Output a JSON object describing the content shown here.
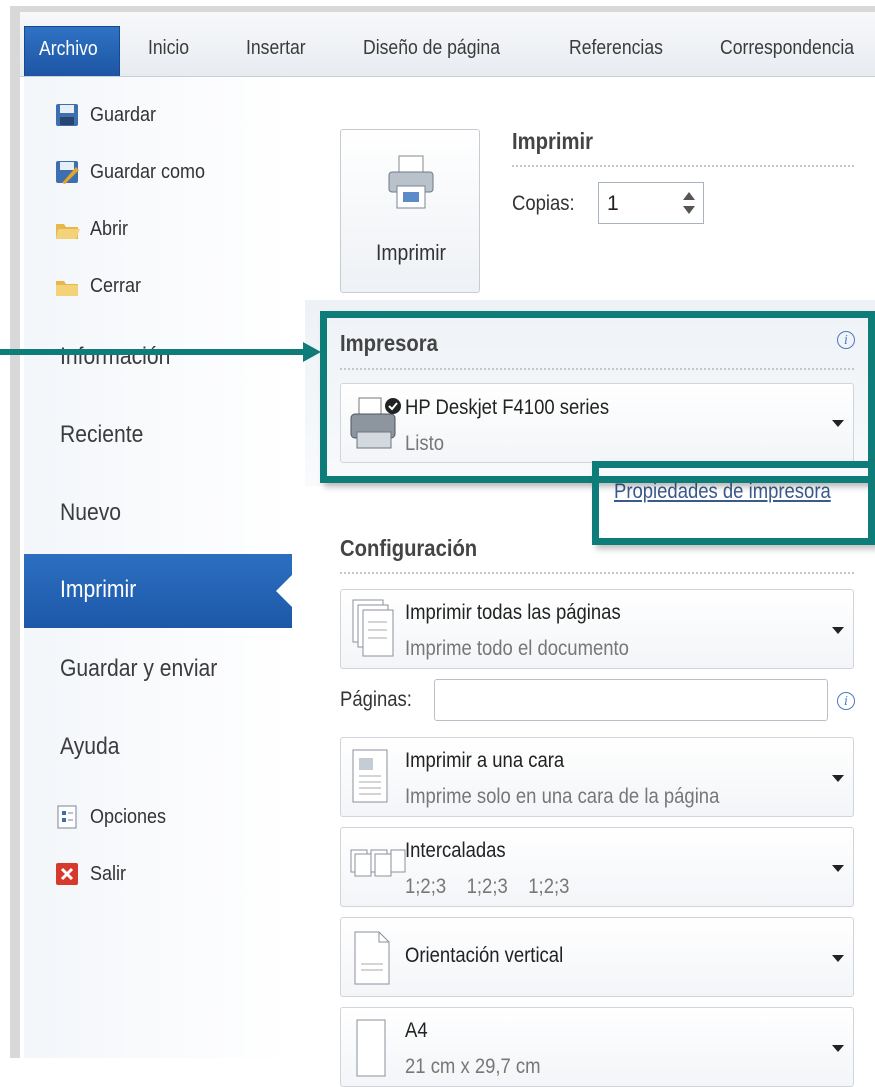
{
  "ribbon": {
    "tabs": [
      "Archivo",
      "Inicio",
      "Insertar",
      "Diseño de página",
      "Referencias",
      "Correspondencia"
    ],
    "active_tab": "Archivo"
  },
  "sidebar": {
    "small_items": [
      {
        "label": "Guardar",
        "icon": "save-icon"
      },
      {
        "label": "Guardar como",
        "icon": "save-as-icon"
      },
      {
        "label": "Abrir",
        "icon": "open-folder-icon"
      },
      {
        "label": "Cerrar",
        "icon": "close-folder-icon"
      }
    ],
    "big_items": [
      "Información",
      "Reciente",
      "Nuevo",
      "Imprimir",
      "Guardar y enviar",
      "Ayuda"
    ],
    "selected": "Imprimir",
    "bottom_items": [
      {
        "label": "Opciones",
        "icon": "options-icon"
      },
      {
        "label": "Salir",
        "icon": "exit-icon"
      }
    ]
  },
  "print": {
    "button_label": "Imprimir",
    "section_title": "Imprimir",
    "copies_label": "Copias:",
    "copies_value": "1"
  },
  "printer": {
    "section_title": "Impresora",
    "name": "HP Deskjet F4100 series",
    "status": "Listo",
    "properties_link": "Propiedades de impresora"
  },
  "settings": {
    "section_title": "Configuración",
    "pages_label": "Páginas:",
    "pages_value": "",
    "dropdowns": [
      {
        "title": "Imprimir todas las páginas",
        "subtitle": "Imprime todo el documento",
        "icon": "pages-icon"
      },
      {
        "title": "Imprimir a una cara",
        "subtitle": "Imprime solo en una cara de la página",
        "icon": "one-side-icon"
      },
      {
        "title": "Intercaladas",
        "subtitle": "1;2;3    1;2;3    1;2;3",
        "icon": "collate-icon"
      },
      {
        "title": "Orientación vertical",
        "subtitle": "",
        "icon": "portrait-icon"
      },
      {
        "title": "A4",
        "subtitle": "21 cm x 29,7 cm",
        "icon": "paper-size-icon"
      }
    ]
  },
  "colors": {
    "accent_blue": "#1d58a8",
    "highlight_teal": "#0e7c78"
  }
}
